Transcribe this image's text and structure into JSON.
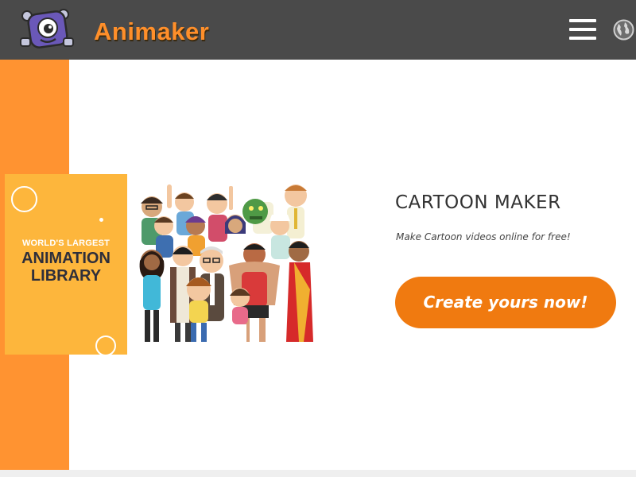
{
  "header": {
    "logo_text": "Animaker",
    "menu_icon": "hamburger-menu-icon",
    "language_icon": "globe-icon"
  },
  "promo_card": {
    "line1": "WORLD'S LARGEST",
    "line2": "ANIMATION",
    "line3": "LIBRARY"
  },
  "hero": {
    "title": "CARTOON MAKER",
    "subtitle": "Make Cartoon videos online for free!",
    "cta_label": "Create yours now!"
  },
  "colors": {
    "topbar": "#4a4a4a",
    "brand_orange": "#ff9331",
    "cta_orange": "#f07a10",
    "card_yellow": "#fdb63c"
  }
}
